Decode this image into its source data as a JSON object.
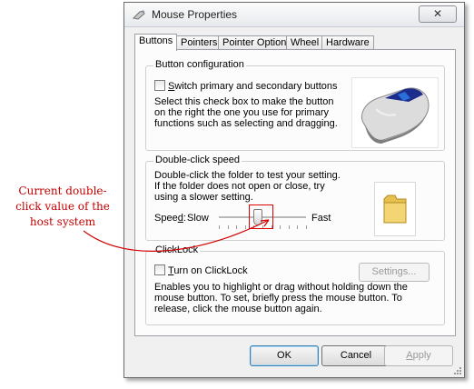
{
  "window": {
    "title": "Mouse Properties",
    "close_glyph": "✕"
  },
  "tabs": [
    {
      "label": "Buttons",
      "active": true
    },
    {
      "label": "Pointers",
      "active": false
    },
    {
      "label": "Pointer Options",
      "active": false
    },
    {
      "label": "Wheel",
      "active": false
    },
    {
      "label": "Hardware",
      "active": false
    }
  ],
  "button_config": {
    "group_label": "Button configuration",
    "checkbox_label_u": "S",
    "checkbox_label_rest": "witch primary and secondary buttons",
    "checked": false,
    "description": "Select this check box to make the button on the right the one you use for primary functions such as selecting and dragging."
  },
  "double_click": {
    "group_label": "Double-click speed",
    "description": "Double-click the folder to test your setting. If the folder does not open or close, try using a slower setting.",
    "speed_label_pre": "Spee",
    "speed_label_u": "d",
    "speed_label_post": ":",
    "slow_label": "Slow",
    "fast_label": "Fast",
    "slider_fraction": 0.45
  },
  "clicklock": {
    "group_label": "ClickLock",
    "checkbox_label_u": "T",
    "checkbox_label_rest": "urn on ClickLock",
    "checked": false,
    "settings_label": "Settings...",
    "description": "Enables you to highlight or drag without holding down the mouse button. To set, briefly press the mouse button. To release, click the mouse button again."
  },
  "buttons": {
    "ok": "OK",
    "cancel": "Cancel",
    "apply_u": "A",
    "apply_rest": "pply"
  },
  "annotation": {
    "text": "Current double-click value of the host system",
    "color": "#c40000"
  },
  "icons": {
    "title": "mouse-icon",
    "mouse_preview": "mouse-image",
    "folder": "folder-icon"
  }
}
